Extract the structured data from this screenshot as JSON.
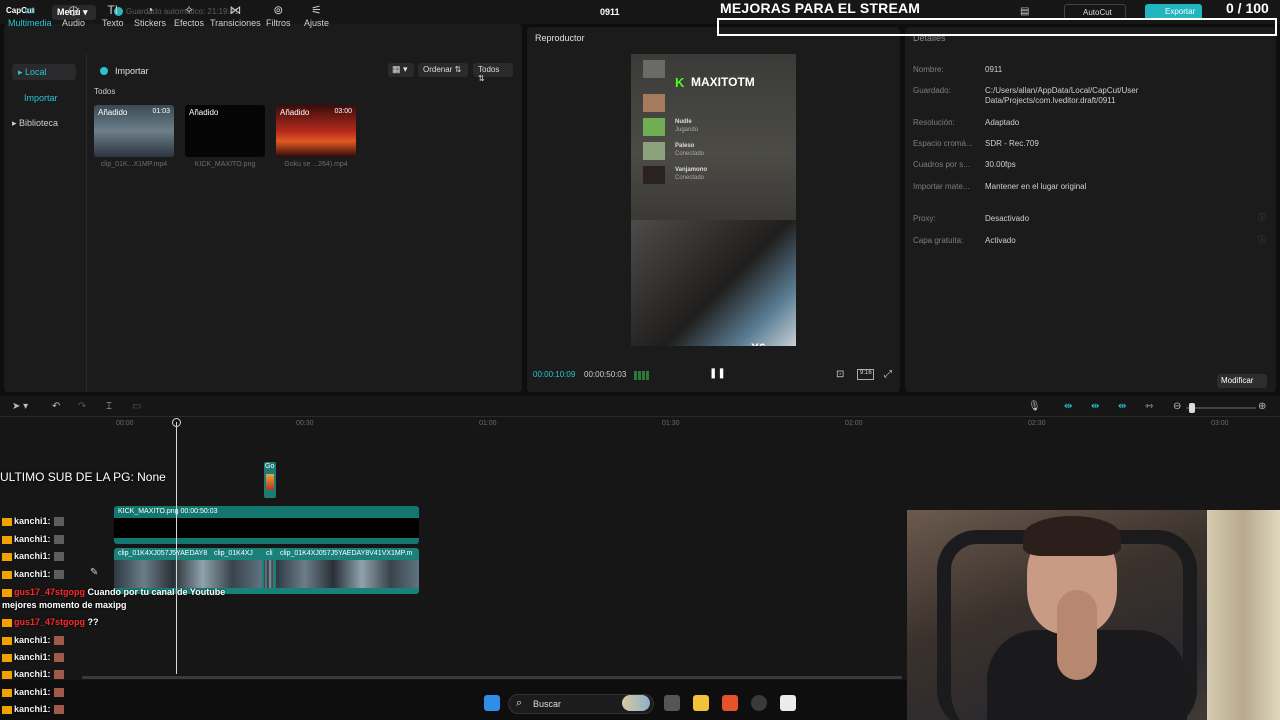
{
  "titlebar": {
    "logo": "CapCut",
    "menu": "Menú ▾",
    "autosave": "Guardado automático: 21:19:41",
    "project_title": "0911",
    "autocut": "AutoCut",
    "export": "Exportar"
  },
  "overlay": {
    "mejoras": "MEJORAS PARA EL STREAM",
    "counter": "0 / 100",
    "ultimo_sub": "ULTIMO SUB DE LA PG: None"
  },
  "media": {
    "tools": [
      "Multimedia",
      "Audio",
      "Texto",
      "Stickers",
      "Efectos",
      "Transiciones",
      "Filtros",
      "Ajuste"
    ],
    "sidebar": {
      "local": "▸ Local",
      "importar": "Importar",
      "biblioteca": "▸ Biblioteca"
    },
    "importar_button": "Importar",
    "ordenar": "Ordenar ⇅",
    "todos_filter": "Todos ⇅",
    "todos_label": "Todos",
    "items": [
      {
        "badge": "Añadido",
        "duration": "01:03",
        "name": "clip_01K...X1MP.mp4"
      },
      {
        "badge": "Añadido",
        "duration": "",
        "name": "KICK_MAXITO.png"
      },
      {
        "badge": "Añadido",
        "duration": "03:00",
        "name": "Goku se ...264).mp4"
      }
    ]
  },
  "player": {
    "title": "Reproductor",
    "time_current": "00:00:10:09",
    "time_total": "00:00:50:03",
    "ratio": "9:16",
    "video": {
      "kick_logo": "K",
      "kick_name": "MAXITOTM",
      "multiplier": "X6",
      "rows": [
        {
          "name": "Nudle",
          "status": "Jugando"
        },
        {
          "name": "Paleso",
          "status": "Conectado"
        },
        {
          "name": "Vanjamono",
          "status": "Conectado"
        }
      ]
    }
  },
  "details": {
    "title": "Detalles",
    "rows": [
      {
        "label": "Nombre:",
        "value": "0911"
      },
      {
        "label": "Guardado:",
        "value": "C:/Users/allan/AppData/Local/CapCut/User Data/Projects/com.lveditor.draft/0911"
      },
      {
        "label": "Resolución:",
        "value": "Adaptado"
      },
      {
        "label": "Espacio cromá...",
        "value": "SDR - Rec.709"
      },
      {
        "label": "Cuadros por s...",
        "value": "30.00fps"
      },
      {
        "label": "Importar mate...",
        "value": "Mantener en el lugar original"
      },
      {
        "label": "Proxy:",
        "value": "Desactivado"
      },
      {
        "label": "Capa gratuita:",
        "value": "Activado"
      }
    ],
    "modificar": "Modificar"
  },
  "timeline": {
    "ruler": [
      "00:00",
      "00:30",
      "01:00",
      "01:30",
      "02:00",
      "02:30",
      "03:00"
    ],
    "small_clip": "Go",
    "png_track": "KICK_MAXITO.png   00:00:50:03",
    "video_clips": [
      "clip_01K4XJ057J5YAEDAY8",
      "clip_01K4XJ",
      "cli",
      "clip_01K4XJ057J5YAEDAY8V41VX1MP.m"
    ]
  },
  "chat": [
    {
      "user": "kanchi1:",
      "type": "normal"
    },
    {
      "user": "kanchi1:",
      "type": "normal"
    },
    {
      "user": "kanchi1:",
      "type": "normal"
    },
    {
      "user": "kanchi1:",
      "type": "normal"
    },
    {
      "user": "gus17_47stgopg",
      "message": "Cuando por tu canal de Youtube",
      "type": "red"
    },
    {
      "user": "",
      "message": "mejores momento de maxipg",
      "type": "cont"
    },
    {
      "user": "gus17_47stgopg",
      "message": "??",
      "type": "red"
    },
    {
      "user": "kanchi1:",
      "type": "normal"
    },
    {
      "user": "kanchi1:",
      "type": "normal"
    },
    {
      "user": "kanchi1:",
      "type": "normal"
    },
    {
      "user": "kanchi1:",
      "type": "normal"
    },
    {
      "user": "kanchi1:",
      "type": "normal"
    }
  ],
  "taskbar": {
    "search": "Buscar"
  },
  "colors": {
    "accent": "#29c5d0",
    "export": "#21b5c0",
    "track": "#14776f",
    "kick": "#53fc18"
  }
}
